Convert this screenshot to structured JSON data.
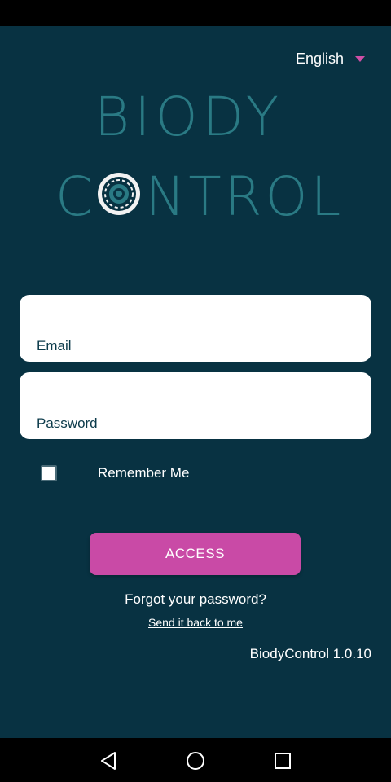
{
  "language": {
    "selected": "English"
  },
  "logo": {
    "line1": "BIODY",
    "line2_left": "C",
    "line2_right": "NTROL"
  },
  "form": {
    "email_label": "Email",
    "password_label": "Password",
    "remember_label": "Remember Me",
    "remember_checked": false,
    "access_label": "ACCESS"
  },
  "links": {
    "forgot": "Forgot your password?",
    "send": "Send it back to me"
  },
  "footer": {
    "version": "BiodyControl 1.0.10"
  },
  "colors": {
    "background": "#083242",
    "accent": "#c94aa6",
    "logo_text": "#2a7a84"
  },
  "icons": {
    "language_caret": "chevron-down-icon",
    "logo_target": "target-icon",
    "nav_back": "back-triangle-icon",
    "nav_home": "home-circle-icon",
    "nav_recent": "recent-square-icon"
  }
}
